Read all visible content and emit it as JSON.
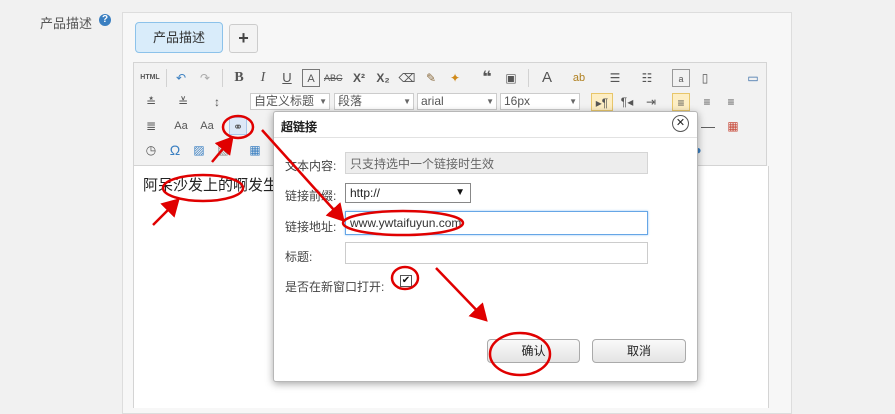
{
  "field": {
    "label": "产品描述",
    "help_icon": "?"
  },
  "tabs": {
    "active_label": "产品描述",
    "add_label": "+"
  },
  "toolbar": {
    "source_label": "HTML",
    "paragraph_style": "自定义标题",
    "paragraph_format": "段落",
    "font_family": "arial",
    "font_size": "16px"
  },
  "editor": {
    "content": "阿呆沙发上的啊发生"
  },
  "dialog": {
    "title": "超链接",
    "close_label": "✕",
    "text_label": "文本内容:",
    "text_value": "只支持选中一个链接时生效",
    "prefix_label": "链接前缀:",
    "prefix_value": "http://",
    "url_label": "链接地址:",
    "url_value": "www.ywtaifuyun.com",
    "title_label": "标题:",
    "title_value": "",
    "new_window_label": "是否在新窗口打开:",
    "new_window_checked": true,
    "confirm_label": "确认",
    "cancel_label": "取消"
  },
  "colors": {
    "annotation": "#e00000",
    "accent": "#3a7fc1",
    "tab_active_bg": "#d9ecfa"
  }
}
